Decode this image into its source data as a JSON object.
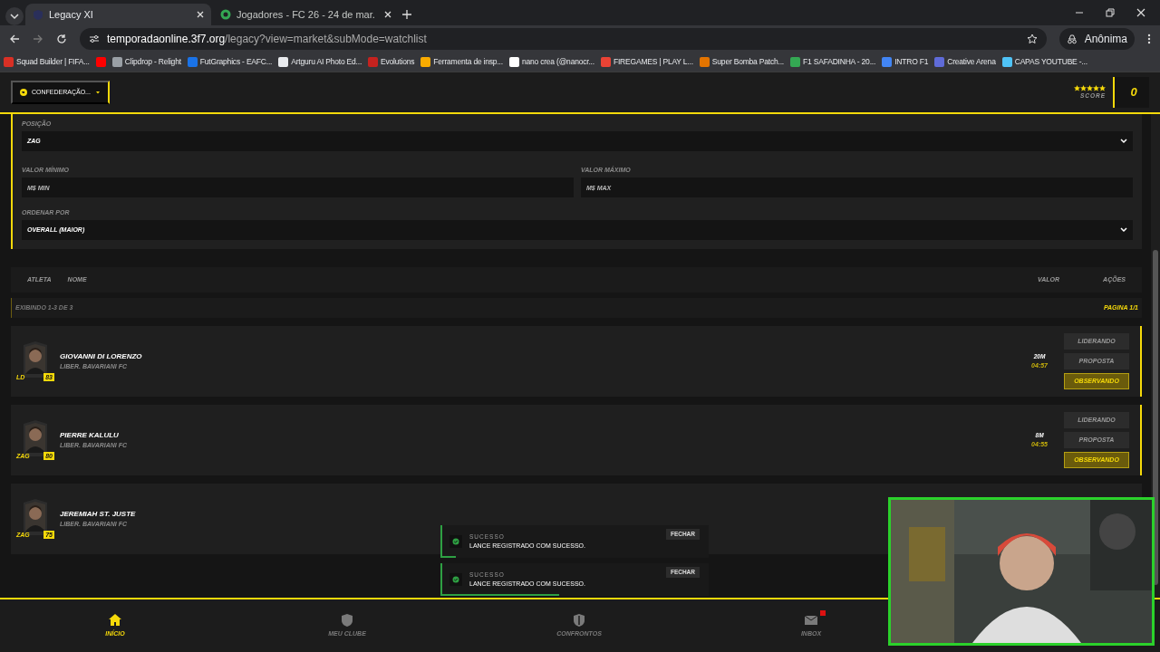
{
  "browser": {
    "tabs": [
      {
        "title": "Legacy XI",
        "selected": true
      },
      {
        "title": "Jogadores - FC 26 - 24 de mar.",
        "selected": false
      }
    ],
    "url_host": "temporadaonline.3f7.org",
    "url_path": "/legacy?view=market&subMode=watchlist",
    "profile": "Anônima",
    "bookmarks": [
      {
        "label": "Squad Builder | FIFA...",
        "color": "#d93025"
      },
      {
        "color": "#ff0000"
      },
      {
        "label": "Clipdrop - Relight",
        "color": "#9aa0a6"
      },
      {
        "label": "FutGraphics - EAFC...",
        "color": "#1a73e8"
      },
      {
        "label": "Artguru AI Photo Ed...",
        "color": "#e8eaed"
      },
      {
        "label": "Evolutions",
        "color": "#c5221f"
      },
      {
        "label": "Ferramenta de insp...",
        "color": "#f9ab00"
      },
      {
        "label": "nano crea (@nanocr...",
        "color": "#ffffff"
      },
      {
        "label": "FIREGAMES | PLAY L...",
        "color": "#ea4335"
      },
      {
        "label": "Super Bomba Patch...",
        "color": "#e37400"
      },
      {
        "label": "F1 SAFADINHA - 20...",
        "color": "#34a853"
      },
      {
        "label": "INTRO F1",
        "color": "#4285f4"
      },
      {
        "label": "Creative Arena",
        "color": "#5f6bd8"
      },
      {
        "label": "CAPAS YOUTUBE -...",
        "color": "#4fc3f7"
      }
    ]
  },
  "header": {
    "confederation": "CONFEDERAÇÃO...",
    "stars": 5,
    "score_label": "SCORE",
    "coins": "0"
  },
  "filters": {
    "position": {
      "label": "POSIÇÃO",
      "value": "ZAG"
    },
    "min": {
      "label": "VALOR MÍNIMO",
      "placeholder": "M$ MIN"
    },
    "max": {
      "label": "VALOR MÁXIMO",
      "placeholder": "M$ MAX"
    },
    "sort": {
      "label": "ORDENAR POR",
      "value": "OVERALL (MAIOR)"
    }
  },
  "table": {
    "columns": [
      "ATLETA",
      "NOME",
      "VALOR",
      "AÇÕES"
    ],
    "showing": "EXIBINDO 1-3 DE 3",
    "page": "PAGINA 1/1"
  },
  "players": [
    {
      "name": "GIOVANNI DI LORENZO",
      "club": "LIBER. BAVARIANI FC",
      "position": "LD",
      "overall": "83",
      "value": "20M",
      "time": "04:57",
      "actions": [
        {
          "label": "LIDERANDO",
          "active": false
        },
        {
          "label": "PROPOSTA",
          "active": false
        },
        {
          "label": "OBSERVANDO",
          "active": true
        }
      ]
    },
    {
      "name": "PIERRE KALULU",
      "club": "LIBER. BAVARIANI FC",
      "position": "ZAG",
      "overall": "80",
      "value": "8M",
      "time": "04:55",
      "actions": [
        {
          "label": "LIDERANDO",
          "active": false
        },
        {
          "label": "PROPOSTA",
          "active": false
        },
        {
          "label": "OBSERVANDO",
          "active": true
        }
      ]
    },
    {
      "name": "JEREMIAH ST. JUSTE",
      "club": "LIBER. BAVARIANI FC",
      "position": "ZAG",
      "overall": "75"
    }
  ],
  "toasts": [
    {
      "title": "SUCESSO",
      "message": "LANCE REGISTRADO COM SUCESSO.",
      "close": "FECHAR",
      "level": 0.05
    },
    {
      "title": "SUCESSO",
      "message": "LANCE REGISTRADO COM SUCESSO.",
      "close": "FECHAR",
      "level": 0.44
    }
  ],
  "nav": [
    {
      "label": "INÍCIO",
      "selected": true,
      "badge": false
    },
    {
      "label": "MEU CLUBE",
      "selected": false,
      "badge": false
    },
    {
      "label": "CONFRONTOS",
      "selected": false,
      "badge": false
    },
    {
      "label": "INBOX",
      "selected": false,
      "badge": true
    }
  ]
}
